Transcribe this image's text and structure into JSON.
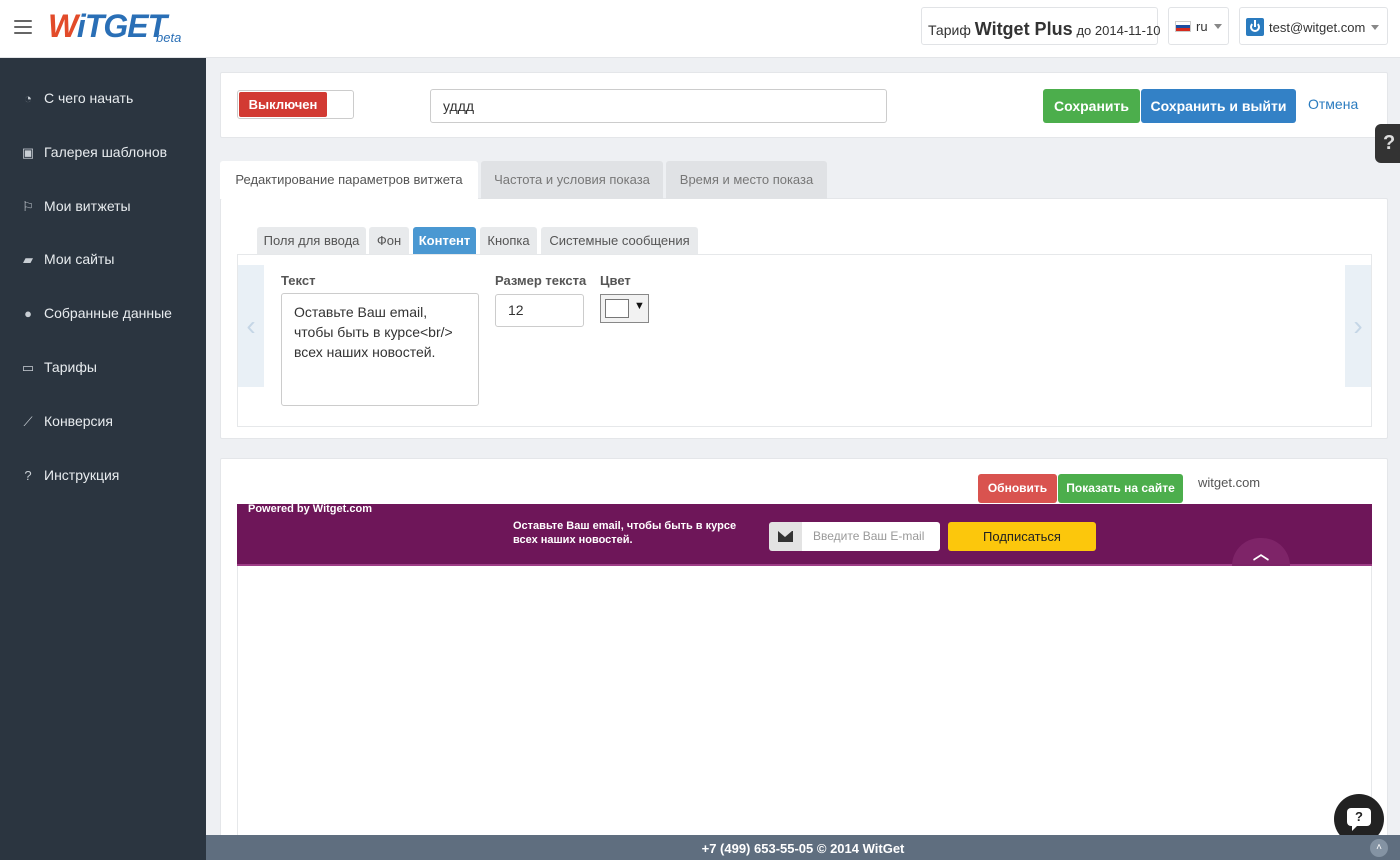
{
  "header": {
    "logo_text_first": "W",
    "logo_text_rest": "iTGET",
    "logo_beta": "beta",
    "tariff_prefix": "Тариф",
    "tariff_plan": "Witget Plus",
    "tariff_until": "до 2014-11-10",
    "language": "ru",
    "user_email": "test@witget.com"
  },
  "sidebar": {
    "items": [
      {
        "label": "С чего начать",
        "icon": "dashboard-icon",
        "glyph": "◔"
      },
      {
        "label": "Галерея шаблонов",
        "icon": "picture-icon",
        "glyph": "▣"
      },
      {
        "label": "Мои витжеты",
        "icon": "flag-icon",
        "glyph": "⚐"
      },
      {
        "label": "Мои сайты",
        "icon": "folder-icon",
        "glyph": "▰"
      },
      {
        "label": "Собранные данные",
        "icon": "user-icon",
        "glyph": "●"
      },
      {
        "label": "Тарифы",
        "icon": "money-icon",
        "glyph": "▭"
      },
      {
        "label": "Конверсия",
        "icon": "line-chart-icon",
        "glyph": "⟋"
      },
      {
        "label": "Инструкция",
        "icon": "question-icon",
        "glyph": "?"
      }
    ]
  },
  "toolbar": {
    "toggle_label": "Выключен",
    "widget_name": "уддд",
    "save_label": "Сохранить",
    "save_exit_label": "Сохранить и выйти",
    "cancel_label": "Отмена"
  },
  "tabs": [
    {
      "label": "Редактирование параметров витжета",
      "active": true
    },
    {
      "label": "Частота и условия показа",
      "active": false
    },
    {
      "label": "Время и место показа",
      "active": false
    }
  ],
  "subtabs": [
    {
      "label": "Поля для ввода",
      "active": false
    },
    {
      "label": "Фон",
      "active": false
    },
    {
      "label": "Контент",
      "active": true
    },
    {
      "label": "Кнопка",
      "active": false
    },
    {
      "label": "Системные сообщения",
      "active": false
    }
  ],
  "content": {
    "text_label": "Текст",
    "text_value": "Оставьте Ваш email,\nчтобы быть в курсе<br/>\nвсех наших новостей.",
    "size_label": "Размер текста",
    "size_value": "12",
    "color_label": "Цвет",
    "color_value": "#ffffff"
  },
  "preview": {
    "refresh_label": "Обновить",
    "show_on_site_label": "Показать на сайте",
    "site": "witget.com",
    "powered_by": "Powered by Witget.com",
    "widget_text": "Оставьте Ваш email, чтобы быть в курсе всех наших новостей.",
    "email_placeholder": "Введите Ваш E-mail",
    "subscribe_label": "Подписаться",
    "widget_bg_color": "#6e1659",
    "button_color": "#fcc70c"
  },
  "footer": {
    "text": "+7 (499) 653-55-05 © 2014 WitGet"
  },
  "colors": {
    "sidebar_bg": "#2b3540",
    "accent_blue": "#3381c6",
    "accent_green": "#4cae4c",
    "accent_red": "#d9534f"
  }
}
